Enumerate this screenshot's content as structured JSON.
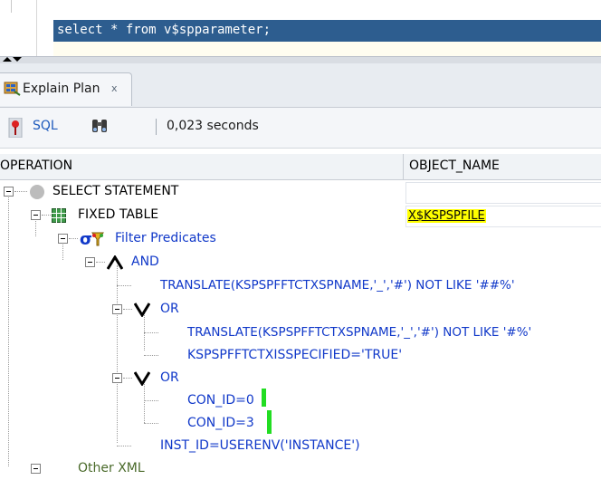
{
  "editor": {
    "code": "select * from v$spparameter;"
  },
  "tab": {
    "label": "Explain Plan",
    "close": "x"
  },
  "toolbar": {
    "sql_label": "SQL",
    "elapsed": "0,023 seconds"
  },
  "columns": {
    "operation": "OPERATION",
    "object_name": "OBJECT_NAME"
  },
  "tree": {
    "select_statement": "SELECT STATEMENT",
    "fixed_table": "FIXED TABLE",
    "fixed_table_object": "X$KSPSPFILE",
    "filter_predicates": "Filter Predicates",
    "and": "AND",
    "pred1": "TRANSLATE(KSPSPFFTCTXSPNAME,'_','#') NOT LIKE '##%'",
    "or1": "OR",
    "pred2": "TRANSLATE(KSPSPFFTCTXSPNAME,'_','#') NOT LIKE '#%'",
    "pred3": "KSPSPFFTCTXISSPECIFIED='TRUE'",
    "or2": "OR",
    "pred4": "CON_ID=0",
    "pred5": "CON_ID=3",
    "pred6": "INST_ID=USERENV('INSTANCE')",
    "other_xml": "Other XML"
  },
  "colors": {
    "editor_highlight": "#2d5d8f",
    "predicate_text": "#1038c9",
    "object_highlight": "#ffff00"
  }
}
